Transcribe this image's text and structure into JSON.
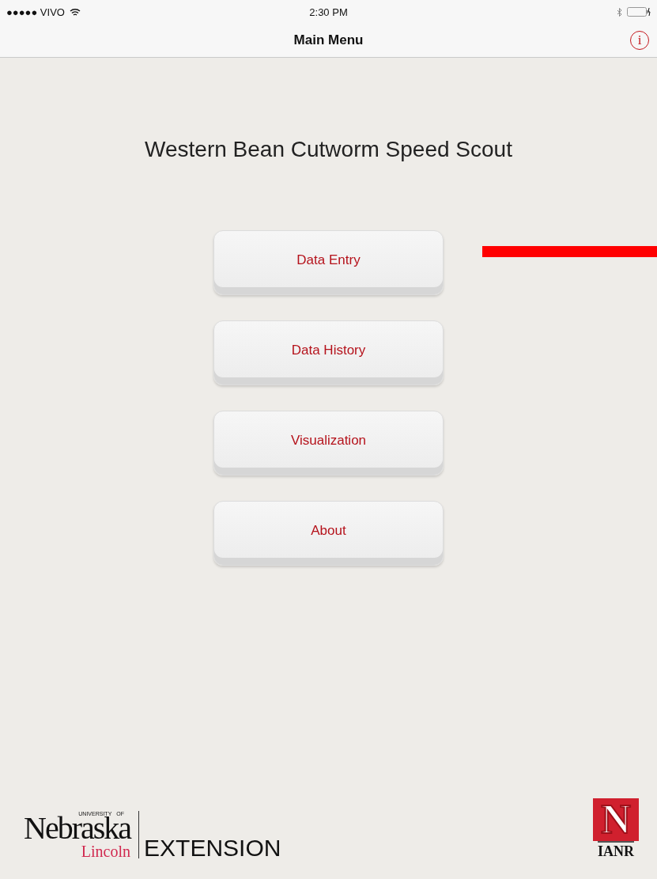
{
  "status_bar": {
    "carrier": "●●●●● VIVO",
    "time": "2:30 PM"
  },
  "nav_bar": {
    "title": "Main Menu",
    "info_button": "i"
  },
  "app_title": "Western Bean Cutworm Speed Scout",
  "menu_buttons": [
    {
      "label": "Data Entry",
      "pointed": true
    },
    {
      "label": "Data History",
      "pointed": false
    },
    {
      "label": "Visualization",
      "pointed": false
    },
    {
      "label": "About",
      "pointed": false
    }
  ],
  "footer": {
    "extension_logo": {
      "university": "UNIVERSITY",
      "of": "OF",
      "name": "Nebraska",
      "campus": "Lincoln",
      "unit": "EXTENSION"
    },
    "ianr_logo": {
      "letter": "N",
      "text": "IANR"
    }
  }
}
